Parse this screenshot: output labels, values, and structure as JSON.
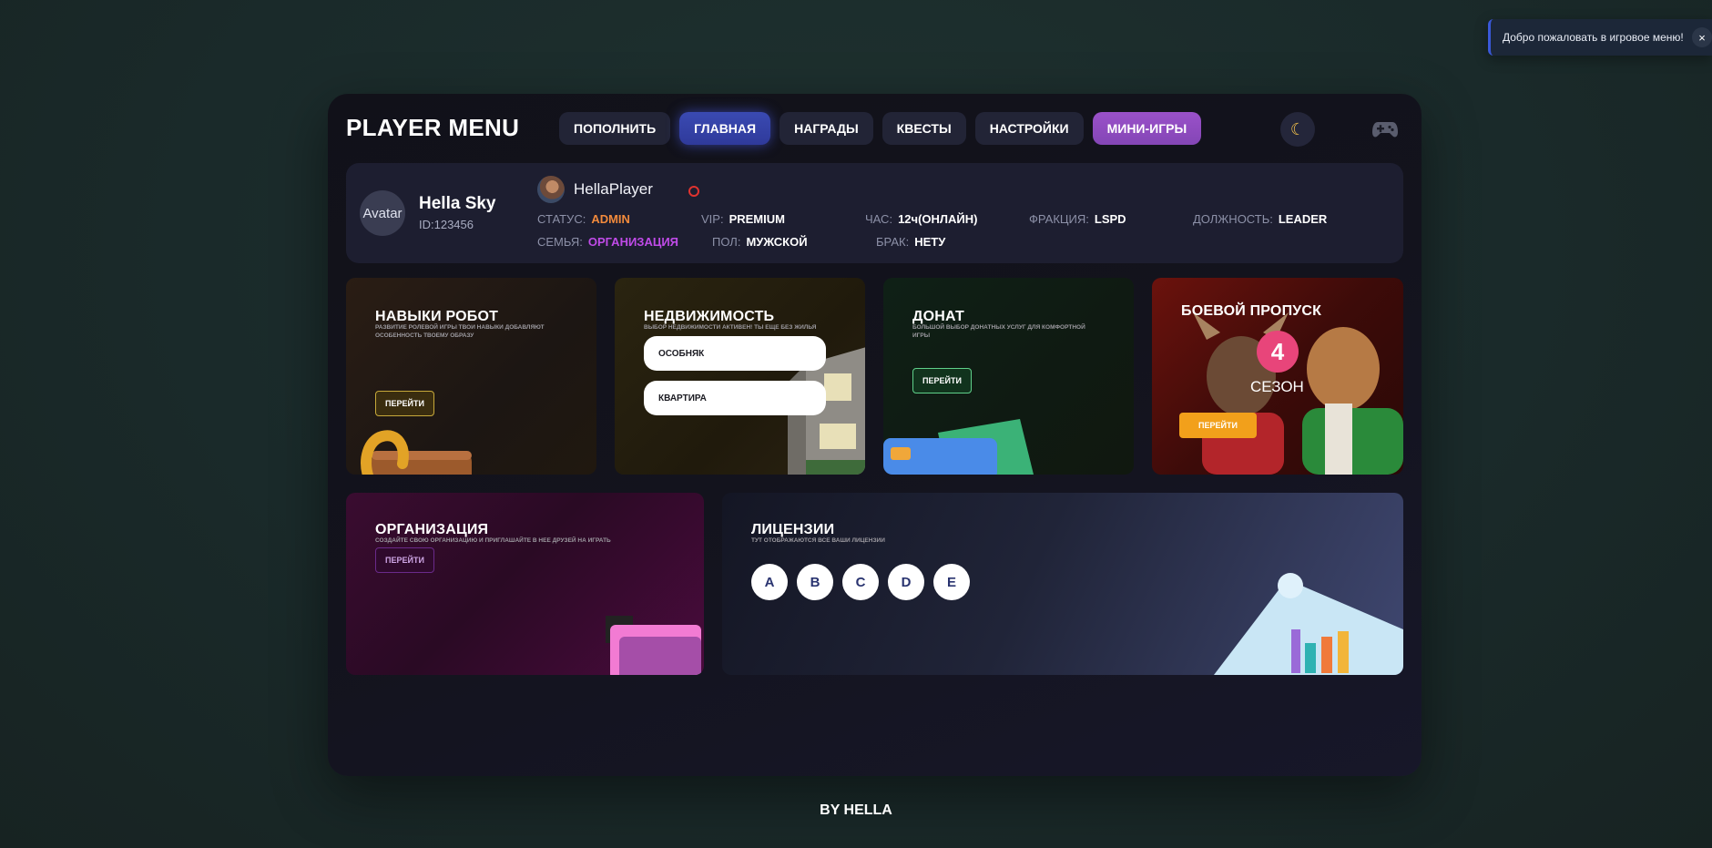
{
  "toast": {
    "text": "Добро пожаловать в игровое меню!",
    "close": "×"
  },
  "brand": "PLAYER MENU",
  "nav": {
    "items": [
      "ПОПОЛНИТЬ",
      "ГЛАВНАЯ",
      "НАГРАДЫ",
      "КВЕСТЫ",
      "НАСТРОЙКИ",
      "МИНИ-ИГРЫ"
    ],
    "active": "ГЛАВНАЯ",
    "theme_icon": "moon-icon",
    "gamepad_icon": "gamepad-icon"
  },
  "profile": {
    "avatar_alt": "Avatar",
    "name": "Hella Sky",
    "id": "ID:123456",
    "username": "HellaPlayer",
    "stats": {
      "status": {
        "label": "СТАТУС:",
        "value": "ADMIN"
      },
      "vip": {
        "label": "VIP:",
        "value": "PREMIUM"
      },
      "hours": {
        "label": "ЧАС:",
        "value": "12ч(ОНЛАЙН)"
      },
      "faction": {
        "label": "ФРАКЦИЯ:",
        "value": "LSPD"
      },
      "position": {
        "label": "ДОЛЖНОСТЬ:",
        "value": "LEADER"
      },
      "family": {
        "label": "СЕМЬЯ:",
        "value": "ОРГАНИЗАЦИЯ"
      },
      "gender": {
        "label": "ПОЛ:",
        "value": "МУЖСКОЙ"
      },
      "marriage": {
        "label": "БРАК:",
        "value": "НЕТУ"
      }
    }
  },
  "cards": {
    "skills": {
      "title": "НАВЫКИ РОБОТ",
      "subtitle": "РАЗВИТИЕ РОЛЕВОЙ ИГРЫ ТВОИ НАВЫКИ ДОБАВЛЯЮТ ОСОБЕННОСТЬ ТВОЕМУ ОБРАЗУ",
      "button": "ПЕРЕЙТИ"
    },
    "realty": {
      "title": "НЕДВИЖИМОСТЬ",
      "subtitle": "ВЫБОР НЕДВИЖИМОСТИ АКТИВЕН! ТЫ ЕЩЕ БЕЗ ЖИЛЬЯ",
      "options": [
        "ОСОБНЯК",
        "КВАРТИРА"
      ]
    },
    "donate": {
      "title": "ДОНАТ",
      "subtitle": "БОЛЬШОЙ ВЫБОР ДОНАТНЫХ УСЛУГ ДЛЯ КОМФОРТНОЙ ИГРЫ",
      "button": "ПЕРЕЙТИ"
    },
    "pass": {
      "title": "БОЕВОЙ ПРОПУСК",
      "season_number": "4",
      "season_label": "СЕЗОН",
      "button": "ПЕРЕЙТИ"
    },
    "org": {
      "title": "ОРГАНИЗАЦИЯ",
      "subtitle": "СОЗДАЙТЕ СВОЮ ОРГАНИЗАЦИЮ И ПРИГЛАШАЙТЕ В НЕЕ ДРУЗЕЙ НА ИГРАТЬ",
      "button": "ПЕРЕЙТИ"
    },
    "licenses": {
      "title": "ЛИЦЕНЗИИ",
      "subtitle": "ТУТ ОТОБРАЖАЮТСЯ ВСЕ ВАШИ ЛИЦЕНЗИИ",
      "badges": [
        "A",
        "B",
        "C",
        "D",
        "E"
      ]
    }
  },
  "footer": "BY HELLA",
  "colors": {
    "accent": "#3a4ab2",
    "minigames": "#9a51c9",
    "status_admin": "#f28a3c",
    "family": "#c04be8"
  }
}
